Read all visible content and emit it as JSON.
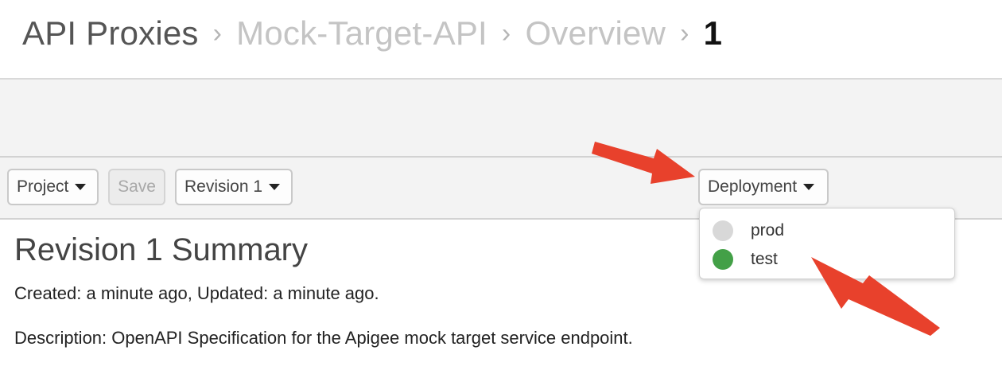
{
  "breadcrumb": {
    "root": "API Proxies",
    "proxy": "Mock-Target-API",
    "section": "Overview",
    "current": "1",
    "separator": "›"
  },
  "toolbar": {
    "project_label": "Project",
    "save_label": "Save",
    "revision_label": "Revision 1",
    "deployment_label": "Deployment"
  },
  "deployment_menu": {
    "items": [
      {
        "label": "prod",
        "status_color": "#d8d8d8"
      },
      {
        "label": "test",
        "status_color": "#43a047"
      }
    ]
  },
  "summary": {
    "title": "Revision 1 Summary",
    "dates": "Created: a minute ago, Updated: a minute ago.",
    "description": "Description: OpenAPI Specification for the Apigee mock target service endpoint."
  },
  "colors": {
    "annotation_arrow": "#e8412c",
    "toolbar_bg": "#f3f3f3"
  }
}
